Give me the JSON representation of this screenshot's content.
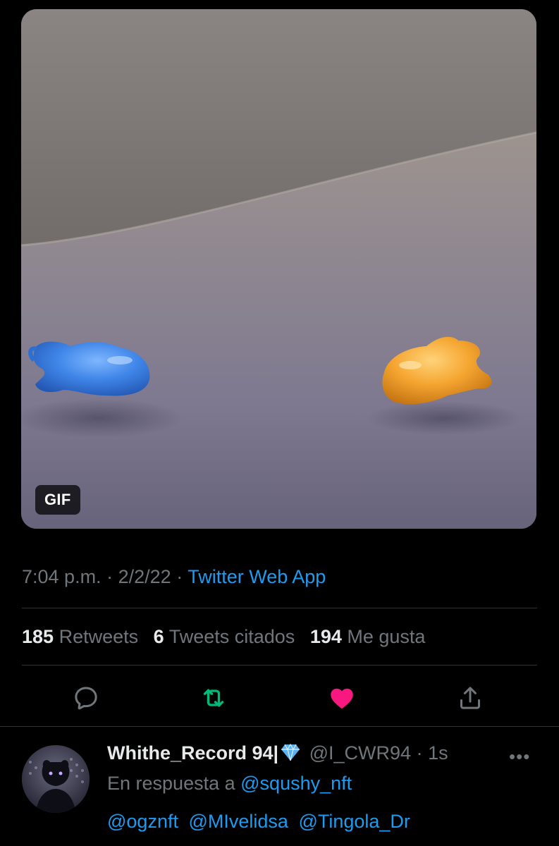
{
  "media": {
    "badge": "GIF",
    "description_icon": "gif-media"
  },
  "tweet_meta": {
    "time": "7:04 p.m.",
    "separator": "·",
    "date": "2/2/22",
    "source": "Twitter Web App"
  },
  "stats": {
    "retweets_count": "185",
    "retweets_label": "Retweets",
    "quotes_count": "6",
    "quotes_label": "Tweets citados",
    "likes_count": "194",
    "likes_label": "Me gusta"
  },
  "actions": [
    {
      "name": "reply",
      "icon": "reply-icon",
      "color": "#71767b"
    },
    {
      "name": "retweet",
      "icon": "retweet-icon",
      "color": "#00ba7c"
    },
    {
      "name": "like",
      "icon": "heart-icon",
      "color": "#f91880",
      "active": true
    },
    {
      "name": "share",
      "icon": "share-icon",
      "color": "#71767b"
    }
  ],
  "reply": {
    "display_name": "Whithe_Record 94|",
    "badge_icon": "diamond-icon",
    "handle": "@I_CWR94",
    "separator": "·",
    "time_ago": "1s",
    "more_icon": "more-icon",
    "more_symbol": "•••",
    "replying_prefix": "En respuesta a",
    "replying_to": "@squshy_nft",
    "mentions": [
      "@ogznft",
      "@MIvelidsa",
      "@Tingola_Dr"
    ]
  },
  "colors": {
    "background": "#000000",
    "text_primary": "#e7e9ea",
    "text_secondary": "#71767b",
    "link": "#1d9bf0",
    "divider": "#2f3336",
    "like": "#f91880",
    "retweet": "#00ba7c"
  }
}
